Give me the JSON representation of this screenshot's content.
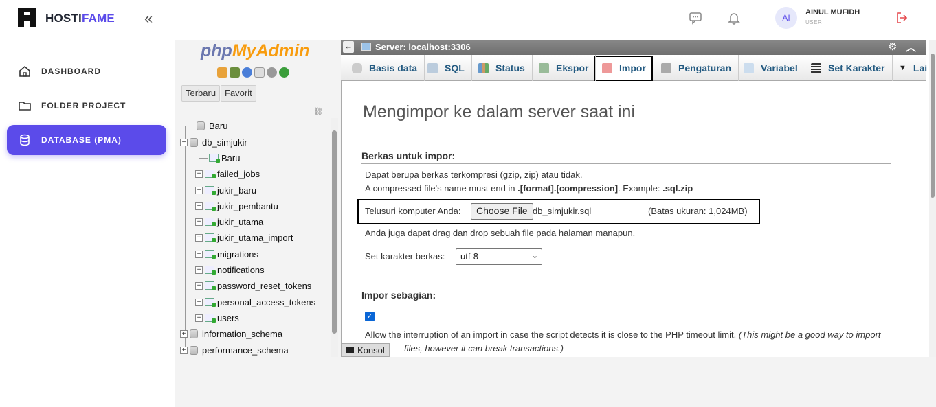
{
  "app": {
    "brand_prefix": "HOSTI",
    "brand_suffix": "FAME",
    "user_initials": "AI",
    "user_name": "AINUL MUFIDH",
    "user_role": "USER"
  },
  "sidebar": {
    "items": [
      {
        "label": "DASHBOARD",
        "icon": "home-icon"
      },
      {
        "label": "FOLDER PROJECT",
        "icon": "folder-icon"
      },
      {
        "label": "DATABASE (PMA)",
        "icon": "database-icon",
        "active": true
      }
    ]
  },
  "pma": {
    "logo_php": "php",
    "logo_my": "My",
    "logo_admin": "Admin",
    "btn_recent": "Terbaru",
    "btn_fav": "Favorit",
    "tree": {
      "new_root": "Baru",
      "db": "db_simjukir",
      "new_db": "Baru",
      "tables": [
        "failed_jobs",
        "jukir_baru",
        "jukir_pembantu",
        "jukir_utama",
        "jukir_utama_import",
        "migrations",
        "notifications",
        "password_reset_tokens",
        "personal_access_tokens",
        "users"
      ],
      "other_dbs": [
        "information_schema",
        "performance_schema"
      ]
    },
    "server": "Server: localhost:3306",
    "tabs": [
      "Basis data",
      "SQL",
      "Status",
      "Ekspor",
      "Impor",
      "Pengaturan",
      "Variabel",
      "Set Karakter",
      "Lai"
    ],
    "active_tab": "Impor",
    "konsol": "Konsol"
  },
  "import": {
    "title": "Mengimpor ke dalam server saat ini",
    "sec_file": "Berkas untuk impor:",
    "line1": "Dapat berupa berkas terkompresi (gzip, zip) atau tidak.",
    "line2_a": "A compressed file's name must end in ",
    "line2_b": ".[format].[compression]",
    "line2_c": ". Example: ",
    "line2_d": ".sql.zip",
    "browse_label": "Telusuri komputer Anda:",
    "choose_btn": "Choose File",
    "file_name": "db_simjukir.sql",
    "max_size": "(Batas ukuran: 1,024MB)",
    "dragdrop": "Anda juga dapat drag dan drop sebuah file pada halaman manapun.",
    "charset_label": "Set karakter berkas:",
    "charset_value": "utf-8",
    "sec_partial": "Impor sebagian:",
    "allow_text": "Allow the interruption of an import in case the script detects it is close to the PHP timeout limit.",
    "allow_note": "(This might be a good way to import",
    "allow_note2": "files, however it can break transactions.)"
  },
  "colors": {
    "accent": "#5b4bea"
  }
}
